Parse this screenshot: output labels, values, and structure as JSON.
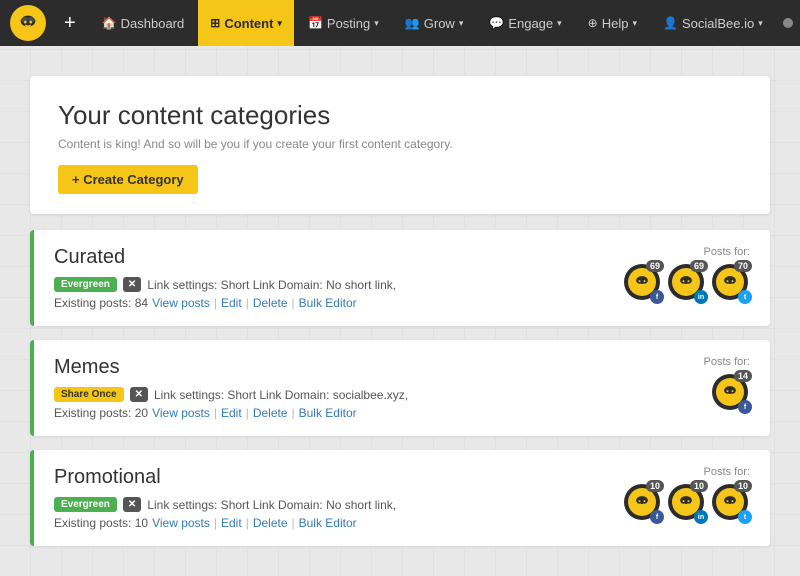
{
  "nav": {
    "plus_label": "+",
    "items": [
      {
        "label": "Dashboard",
        "icon": "🏠",
        "active": false,
        "has_caret": false
      },
      {
        "label": "Content",
        "icon": "⊞",
        "active": true,
        "has_caret": true
      },
      {
        "label": "Posting",
        "icon": "📅",
        "active": false,
        "has_caret": true
      },
      {
        "label": "Grow",
        "icon": "👥",
        "active": false,
        "has_caret": true
      },
      {
        "label": "Engage",
        "icon": "💬",
        "active": false,
        "has_caret": true
      },
      {
        "label": "Help",
        "icon": "⊕",
        "active": false,
        "has_caret": true
      },
      {
        "label": "SocialBee.io",
        "icon": "👤",
        "active": false,
        "has_caret": true
      }
    ]
  },
  "page": {
    "title": "Your content categories",
    "subtitle": "Content is king! And so will be you if you create your first content category.",
    "create_button": "+ Create Category"
  },
  "categories": [
    {
      "name": "Curated",
      "badge_type": "evergreen",
      "badge_label": "Evergreen",
      "x_label": "✕",
      "link_settings": "Link settings: Short Link Domain: No short link,",
      "existing_posts_label": "Existing posts: 84",
      "posts_for_label": "Posts for:",
      "actions": [
        "View posts",
        "Edit",
        "Delete",
        "Bulk Editor"
      ],
      "avatars": [
        {
          "count": "69",
          "social": "fb",
          "color": "#3b5998"
        },
        {
          "count": "69",
          "social": "li",
          "color": "#0077b5"
        },
        {
          "count": "70",
          "social": "tw",
          "color": "#1da1f2"
        }
      ]
    },
    {
      "name": "Memes",
      "badge_type": "shareonce",
      "badge_label": "Share Once",
      "x_label": "✕",
      "link_settings": "Link settings: Short Link Domain: socialbee.xyz,",
      "existing_posts_label": "Existing posts: 20",
      "posts_for_label": "Posts for:",
      "actions": [
        "View posts",
        "Edit",
        "Delete",
        "Bulk Editor"
      ],
      "avatars": [
        {
          "count": "14",
          "social": "fb",
          "color": "#3b5998"
        }
      ]
    },
    {
      "name": "Promotional",
      "badge_type": "evergreen",
      "badge_label": "Evergreen",
      "x_label": "✕",
      "link_settings": "Link settings: Short Link Domain: No short link,",
      "existing_posts_label": "Existing posts: 10",
      "posts_for_label": "Posts for:",
      "actions": [
        "View posts",
        "Edit",
        "Delete",
        "Bulk Editor"
      ],
      "avatars": [
        {
          "count": "10",
          "social": "fb",
          "color": "#3b5998"
        },
        {
          "count": "10",
          "social": "li",
          "color": "#0077b5"
        },
        {
          "count": "10",
          "social": "tw",
          "color": "#1da1f2"
        }
      ]
    }
  ]
}
